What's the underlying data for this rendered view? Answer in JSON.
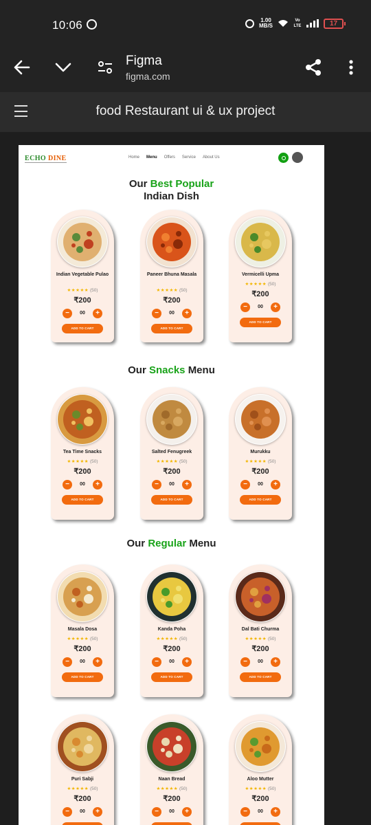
{
  "status": {
    "time": "10:06",
    "speed_top": "1.00",
    "speed_bottom": "MB/S",
    "volte": "Vo LTE",
    "battery": "17"
  },
  "browser": {
    "title": "Figma",
    "url": "figma.com"
  },
  "document": {
    "title": "food Restaurant ui & ux project"
  },
  "site": {
    "logo_a": "ECHO",
    "logo_b": "DINE",
    "nav": [
      "Home",
      "Menu",
      "Offers",
      "Service",
      "About Us"
    ],
    "nav_active": "Menu"
  },
  "sections": [
    {
      "title_pre": "Our",
      "title_hl": "Best Popular",
      "title_post": "",
      "title_line2": "Indian Dish",
      "items": [
        {
          "name": "Indian Vegetable Pulao",
          "rating": "(50)",
          "price": "₹200",
          "qty": "00",
          "cta": "ADD TO CART",
          "colors": [
            "#f4ead8",
            "#e0b070",
            "#5a8a3a",
            "#c04020"
          ]
        },
        {
          "name": "Paneer Bhuna Masala",
          "rating": "(50)",
          "price": "₹200",
          "qty": "00",
          "cta": "ADD TO CART",
          "colors": [
            "#f2e2d0",
            "#d9541a",
            "#f08030",
            "#8a2a08"
          ]
        },
        {
          "name": "Vermicelli Upma",
          "rating": "(50)",
          "price": "₹200",
          "qty": "00",
          "cta": "ADD TO CART",
          "colors": [
            "#eef0e4",
            "#d9b84a",
            "#4a8a2a",
            "#e7c860"
          ]
        }
      ]
    },
    {
      "title_pre": "Our",
      "title_hl": "Snacks",
      "title_post": "Menu",
      "title_line2": "",
      "items": [
        {
          "name": "Tea Time Snacks",
          "rating": "(50)",
          "price": "₹200",
          "qty": "00",
          "cta": "ADD TO CART",
          "colors": [
            "#d89a40",
            "#c06020",
            "#6a8a2a",
            "#f0c060"
          ]
        },
        {
          "name": "Salted Fenugreek",
          "rating": "(50)",
          "price": "₹200",
          "qty": "00",
          "cta": "ADD TO CART",
          "colors": [
            "#f4f0ec",
            "#c08a40",
            "#a06a2a",
            "#d8a860"
          ]
        },
        {
          "name": "Murukku",
          "rating": "(50)",
          "price": "₹200",
          "qty": "00",
          "cta": "ADD TO CART",
          "colors": [
            "#f6f2ee",
            "#c8702a",
            "#a0501a",
            "#e09050"
          ]
        }
      ]
    },
    {
      "title_pre": "Our",
      "title_hl": "Regular",
      "title_post": "Menu",
      "title_line2": "",
      "items": [
        {
          "name": "Masala Dosa",
          "rating": "(50)",
          "price": "₹200",
          "qty": "00",
          "cta": "ADD TO CART",
          "colors": [
            "#f2dcb0",
            "#d8a050",
            "#c06020",
            "#f5ead0"
          ]
        },
        {
          "name": "Kanda Poha",
          "rating": "(50)",
          "price": "₹200",
          "qty": "00",
          "cta": "ADD TO CART",
          "colors": [
            "#203030",
            "#e8c840",
            "#4a9a2a",
            "#f0e070"
          ]
        },
        {
          "name": "Dal Bati Churma",
          "rating": "(50)",
          "price": "₹200",
          "qty": "00",
          "cta": "ADD TO CART",
          "colors": [
            "#5a2a1a",
            "#c8602a",
            "#e0a040",
            "#a03060"
          ]
        }
      ]
    },
    {
      "title_pre": "",
      "title_hl": "",
      "title_post": "",
      "title_line2": "",
      "items": [
        {
          "name": "Puri Sabji",
          "rating": "(50)",
          "price": "₹200",
          "qty": "00",
          "cta": "ADD TO CART",
          "colors": [
            "#a05020",
            "#e0b860",
            "#d88a30",
            "#f0d8a0"
          ]
        },
        {
          "name": "Naan Bread",
          "rating": "(50)",
          "price": "₹200",
          "qty": "00",
          "cta": "ADD TO CART",
          "colors": [
            "#3a5a2a",
            "#c8402a",
            "#e8d8b0",
            "#f0e0c0"
          ]
        },
        {
          "name": "Aloo Mutter",
          "rating": "(50)",
          "price": "₹200",
          "qty": "00",
          "cta": "ADD TO CART",
          "colors": [
            "#f4e8d8",
            "#e09a30",
            "#5a9a30",
            "#c86a1a"
          ]
        }
      ]
    }
  ]
}
